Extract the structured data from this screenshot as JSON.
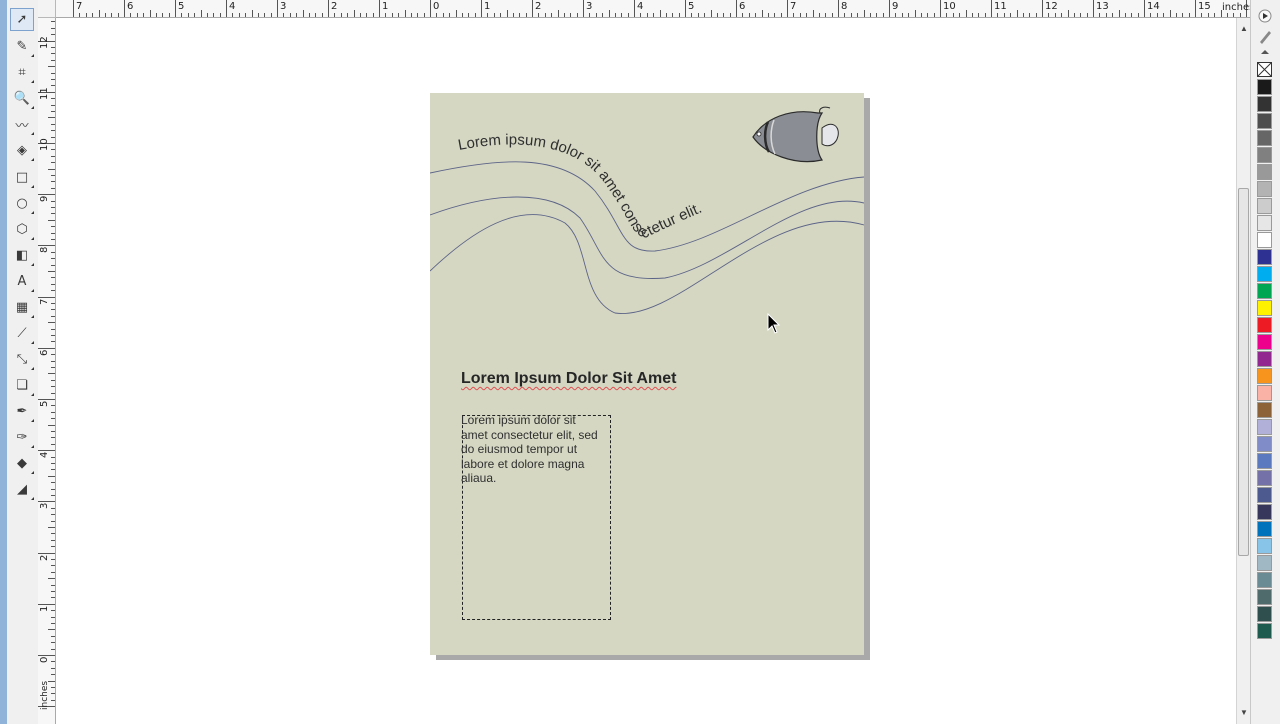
{
  "ruler": {
    "units_label": "inches",
    "units_label_vertical": "inches",
    "top_labels": [
      "7",
      "6",
      "5",
      "4",
      "3",
      "2",
      "1",
      "0",
      "1",
      "2",
      "3",
      "4",
      "5",
      "6",
      "7",
      "8",
      "9",
      "10",
      "11",
      "12",
      "13",
      "14",
      "15"
    ],
    "left_labels": [
      "12",
      "11",
      "10",
      "9",
      "8",
      "7",
      "6",
      "5",
      "4",
      "3",
      "2",
      "1",
      "0"
    ]
  },
  "toolbox": {
    "tools": [
      {
        "name": "pick-tool-icon",
        "glyph": "➚"
      },
      {
        "name": "shape-tool-icon",
        "glyph": "✎"
      },
      {
        "name": "crop-tool-icon",
        "glyph": "⌗"
      },
      {
        "name": "zoom-tool-icon",
        "glyph": "🔍"
      },
      {
        "name": "freehand-tool-icon",
        "glyph": "〰"
      },
      {
        "name": "smart-fill-tool-icon",
        "glyph": "◈"
      },
      {
        "name": "rectangle-tool-icon",
        "glyph": "□"
      },
      {
        "name": "ellipse-tool-icon",
        "glyph": "○"
      },
      {
        "name": "polygon-tool-icon",
        "glyph": "⬡"
      },
      {
        "name": "basic-shapes-tool-icon",
        "glyph": "◧"
      },
      {
        "name": "text-tool-icon",
        "glyph": "A"
      },
      {
        "name": "table-tool-icon",
        "glyph": "▦"
      },
      {
        "name": "dimension-tool-icon",
        "glyph": "⟋"
      },
      {
        "name": "connector-tool-icon",
        "glyph": "⤡"
      },
      {
        "name": "blend-tool-icon",
        "glyph": "❏"
      },
      {
        "name": "eyedropper-tool-icon",
        "glyph": "✒"
      },
      {
        "name": "outline-pen-tool-icon",
        "glyph": "✑"
      },
      {
        "name": "fill-tool-icon",
        "glyph": "◆"
      },
      {
        "name": "interactive-fill-tool-icon",
        "glyph": "◢"
      }
    ]
  },
  "document": {
    "path_text": "Lorem ipsum dolor sit amet consectetur elit.",
    "heading": "Lorem Ipsum Dolor Sit Amet",
    "paragraph_lines": [
      "Lorem ipsum dolor sit",
      "amet consectetur elit, sed",
      "do eiusmod tempor ut",
      "labore et dolore magna",
      "aliaua."
    ]
  },
  "colors": {
    "page": "#d5d7c3",
    "wave_stroke": "#5c6487",
    "fish_body": "#8a8e94"
  },
  "palette": [
    "#1a1a1a",
    "#333333",
    "#4d4d4d",
    "#666666",
    "#808080",
    "#999999",
    "#b3b3b3",
    "#cccccc",
    "#e6e6e6",
    "#ffffff",
    "#2e3192",
    "#00aeef",
    "#00a651",
    "#fff200",
    "#ed1c24",
    "#ec008c",
    "#92278f",
    "#f7941d",
    "#f9b2a5",
    "#8c6239",
    "#b0b0d8",
    "#7f8cc7",
    "#5a79bf",
    "#7470a8",
    "#4d5a8f",
    "#37375b",
    "#0072bc",
    "#87c4e8",
    "#9fb8c4",
    "#6a8a94",
    "#4f6b6b",
    "#2f4f4f",
    "#1f5a4f"
  ]
}
